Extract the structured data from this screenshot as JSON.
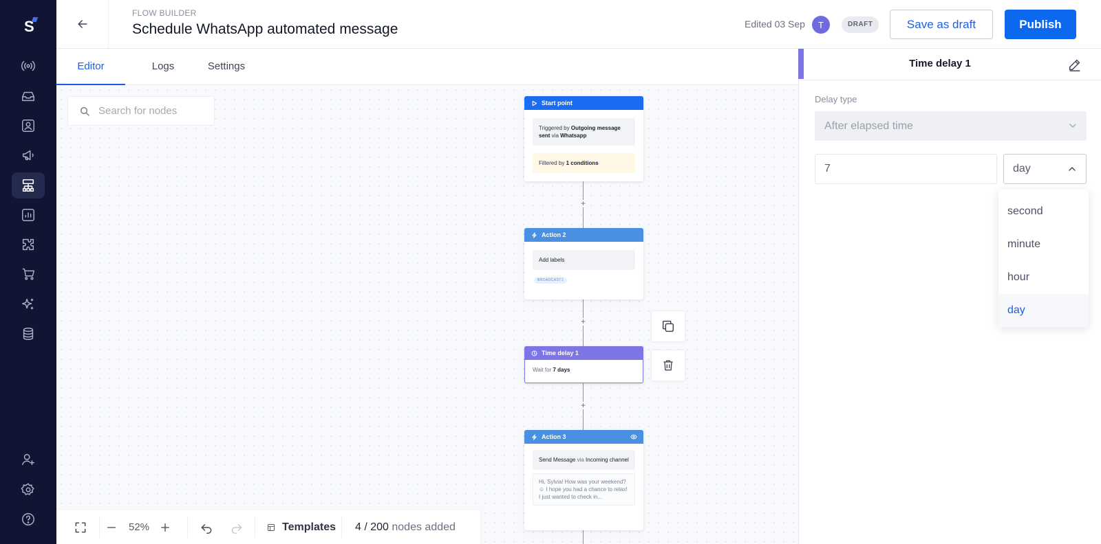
{
  "sidebar": {
    "logo": "S",
    "items": [
      {
        "icon": "broadcast-icon"
      },
      {
        "icon": "inbox-icon"
      },
      {
        "icon": "contacts-icon"
      },
      {
        "icon": "megaphone-icon"
      },
      {
        "icon": "workflow-icon",
        "active": true
      },
      {
        "icon": "reports-icon"
      },
      {
        "icon": "integrations-icon"
      },
      {
        "icon": "cart-icon"
      },
      {
        "icon": "ai-sparkle-icon"
      },
      {
        "icon": "database-icon"
      }
    ],
    "bottom_items": [
      {
        "icon": "add-user-icon"
      },
      {
        "icon": "gear-icon"
      },
      {
        "icon": "help-icon"
      }
    ]
  },
  "header": {
    "eyebrow": "FLOW BUILDER",
    "title": "Schedule WhatsApp automated message",
    "edited": "Edited 03 Sep",
    "avatar_initial": "T",
    "status_badge": "DRAFT",
    "save_draft_label": "Save as draft",
    "publish_label": "Publish"
  },
  "tabs": [
    {
      "label": "Editor",
      "active": true
    },
    {
      "label": "Logs"
    },
    {
      "label": "Settings"
    }
  ],
  "canvas": {
    "search_placeholder": "Search for nodes",
    "nodes": {
      "start": {
        "title": "Start point",
        "trigger_prefix": "Triggered by ",
        "trigger_event": "Outgoing message sent",
        "trigger_via": " via ",
        "trigger_channel": "Whatsapp",
        "filter_prefix": "Filtered by ",
        "filter_value": "1 conditions"
      },
      "action2": {
        "title": "Action 2",
        "body": "Add labels",
        "tag": "BROADCAST1"
      },
      "delay": {
        "title": "Time delay 1",
        "body_prefix": "Wait for ",
        "body_value": "7 days"
      },
      "action3": {
        "title": "Action 3",
        "body_prefix": "Send Message",
        "body_via": " via ",
        "body_channel": "Incoming channel",
        "message": "Hi, Sylvia! How was your weekend? ☺ I hope you had a chance to relax! I just wanted to check in..."
      }
    },
    "plus": "+"
  },
  "toolbar": {
    "zoom": "52%",
    "templates_label": "Templates",
    "nodes_count": "4 / 200",
    "nodes_suffix": " nodes added"
  },
  "panel": {
    "title": "Time delay 1",
    "delay_type_label": "Delay type",
    "delay_type_value": "After elapsed time",
    "amount": "7",
    "unit": "day",
    "unit_options": [
      "second",
      "minute",
      "hour",
      "day"
    ],
    "selected_unit": "day"
  },
  "colors": {
    "sidebar_bg": "#0f1533",
    "primary": "#0d68f0",
    "start_node": "#1a6cf0",
    "action_node": "#4a90e2",
    "delay_node": "#7d74e6"
  }
}
